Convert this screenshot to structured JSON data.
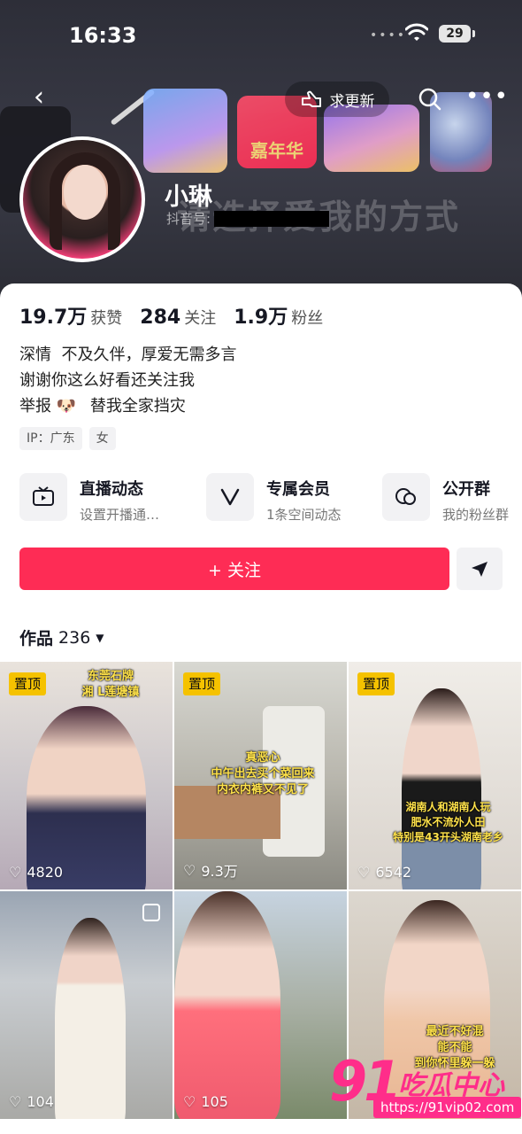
{
  "status": {
    "time": "16:33",
    "battery": "29"
  },
  "header": {
    "seek_update_label": "求更新",
    "username": "小琳",
    "douyin_id_label": "抖音号:",
    "banner_badge": "嘉年华",
    "banner_slogan": "请选择爱我的方式"
  },
  "stats": [
    {
      "value": "19.7万",
      "label": "获赞"
    },
    {
      "value": "284",
      "label": "关注"
    },
    {
      "value": "1.9万",
      "label": "粉丝"
    }
  ],
  "bio": {
    "line1": "深情  不及久伴，厚爱无需多言",
    "line2": "谢谢你这么好看还关注我",
    "line3_a": "举报",
    "line3_emoji": "🐶",
    "line3_b": "替我全家挡灾"
  },
  "tags": {
    "ip": "IP：广东",
    "gender": "女"
  },
  "features": [
    {
      "title": "直播动态",
      "sub": "设置开播通…",
      "icon": "tv-icon"
    },
    {
      "title": "专属会员",
      "sub": "1条空间动态",
      "icon": "v-icon"
    },
    {
      "title": "公开群",
      "sub": "我的粉丝群",
      "icon": "chat-bubbles-icon"
    }
  ],
  "actions": {
    "follow_label": "+ 关注"
  },
  "works": {
    "label": "作品",
    "count": "236"
  },
  "videos": [
    {
      "pinned": "置顶",
      "likes": "4820",
      "caption": "东莞石牌\n湘 L莲塘镇"
    },
    {
      "pinned": "置顶",
      "likes": "9.3万",
      "caption": "真恶心\n中午出去买个菜回来\n内衣内裤又不见了"
    },
    {
      "pinned": "置顶",
      "likes": "6542",
      "caption": "湖南人和湖南人玩\n肥水不流外人田\n特别是43开头湖南老乡"
    },
    {
      "pinned": "",
      "likes": "104",
      "caption": ""
    },
    {
      "pinned": "",
      "likes": "105",
      "caption": ""
    },
    {
      "pinned": "",
      "likes": "",
      "caption": "最近不好混\n能不能\n到你怀里躲一躲"
    }
  ],
  "watermark": {
    "brand_num": "91",
    "brand_text": "吃瓜中心",
    "url": "https://91vip02.com"
  },
  "colors": {
    "accent": "#fe2c55",
    "pin": "#f5c200",
    "watermark": "#ff2d8a"
  }
}
